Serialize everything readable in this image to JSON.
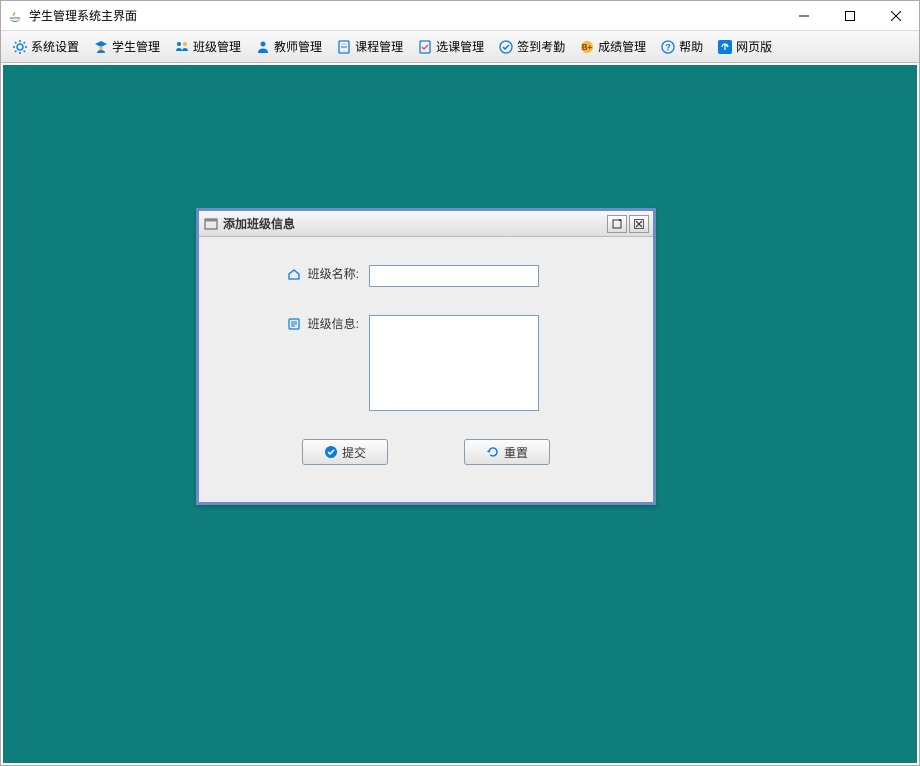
{
  "window": {
    "title": "学生管理系统主界面"
  },
  "menubar": {
    "items": [
      {
        "label": "系统设置"
      },
      {
        "label": "学生管理"
      },
      {
        "label": "班级管理"
      },
      {
        "label": "教师管理"
      },
      {
        "label": "课程管理"
      },
      {
        "label": "选课管理"
      },
      {
        "label": "签到考勤"
      },
      {
        "label": "成绩管理"
      },
      {
        "label": "帮助"
      },
      {
        "label": "网页版"
      }
    ]
  },
  "dialog": {
    "title": "添加班级信息",
    "fields": {
      "class_name_label": "班级名称:",
      "class_name_value": "",
      "class_info_label": "班级信息:",
      "class_info_value": ""
    },
    "buttons": {
      "submit": "提交",
      "reset": "重置"
    }
  }
}
